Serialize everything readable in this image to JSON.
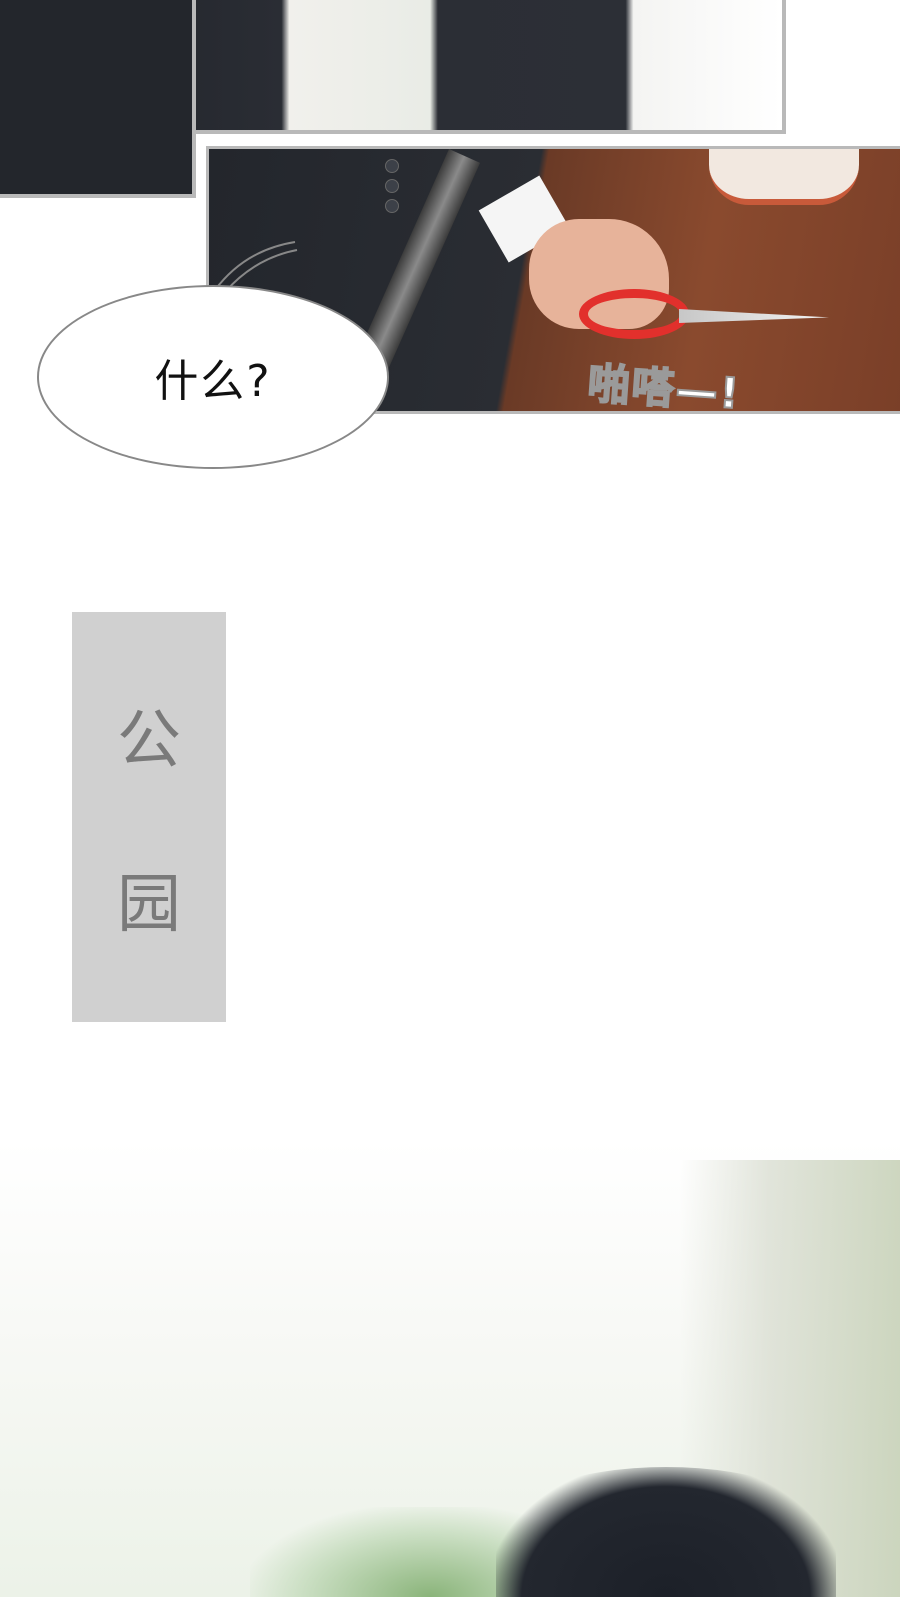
{
  "speech_bubble": {
    "text": "什么?"
  },
  "sound_effect": {
    "text": "啪嗒—!"
  },
  "location_card": {
    "chars": [
      "公",
      "园"
    ]
  }
}
